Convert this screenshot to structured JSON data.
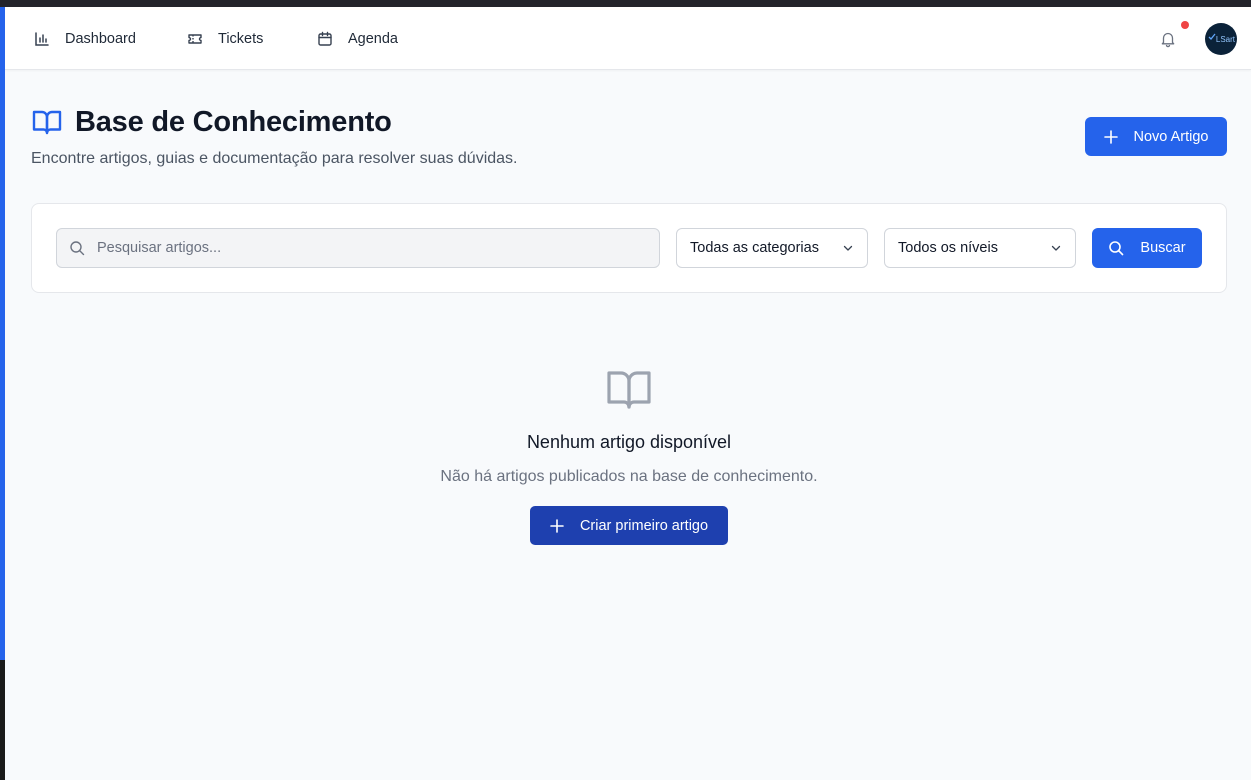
{
  "nav": {
    "items": [
      {
        "label": "Dashboard",
        "icon": "bar-chart-icon"
      },
      {
        "label": "Tickets",
        "icon": "ticket-icon"
      },
      {
        "label": "Agenda",
        "icon": "calendar-icon"
      }
    ],
    "avatar_text": "LSart"
  },
  "header": {
    "title": "Base de Conhecimento",
    "subtitle": "Encontre artigos, guias e documentação para resolver suas dúvidas.",
    "new_button": "Novo Artigo"
  },
  "search": {
    "placeholder": "Pesquisar artigos...",
    "value": "",
    "category": "Todas as categorias",
    "level": "Todos os níveis",
    "button": "Buscar"
  },
  "empty": {
    "title": "Nenhum artigo disponível",
    "subtitle": "Não há artigos publicados na base de conhecimento.",
    "button": "Criar primeiro artigo"
  },
  "colors": {
    "primary": "#2563eb",
    "primary_dark": "#1e40af",
    "notification": "#ef4444"
  }
}
